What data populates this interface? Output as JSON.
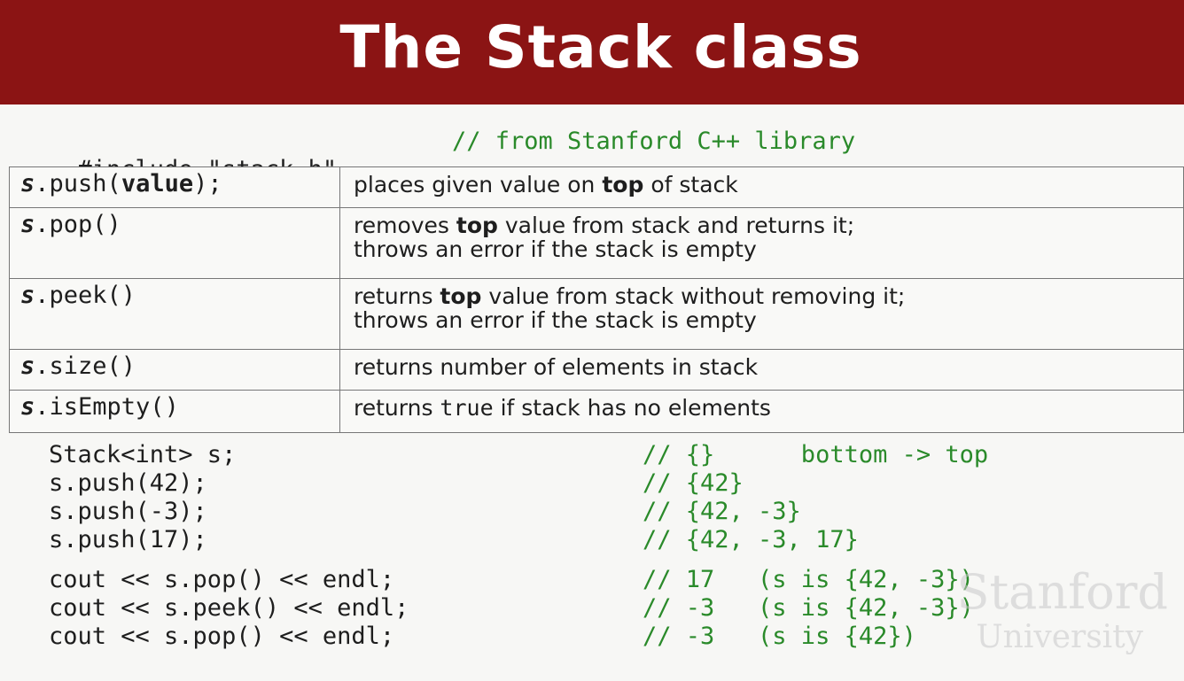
{
  "title": "The Stack class",
  "include": {
    "code": "#include \"stack.h\"",
    "comment": "// from Stanford C++ library"
  },
  "api": [
    {
      "obj": "s",
      "method": ".push(",
      "method_bold": "value",
      "method_tail": ");",
      "desc_lines": [
        {
          "parts": [
            {
              "t": "places given value on "
            },
            {
              "t": "top",
              "b": true
            },
            {
              "t": " of stack"
            }
          ]
        }
      ]
    },
    {
      "obj": "s",
      "method": ".pop()",
      "method_bold": "",
      "method_tail": "",
      "desc_lines": [
        {
          "parts": [
            {
              "t": "removes "
            },
            {
              "t": "top",
              "b": true
            },
            {
              "t": " value from stack and returns it;"
            }
          ]
        },
        {
          "parts": [
            {
              "t": "throws an error if the stack is empty"
            }
          ]
        }
      ]
    },
    {
      "obj": "s",
      "method": ".peek()",
      "method_bold": "",
      "method_tail": "",
      "desc_lines": [
        {
          "parts": [
            {
              "t": "returns "
            },
            {
              "t": "top",
              "b": true
            },
            {
              "t": " value from stack without removing it;"
            }
          ]
        },
        {
          "parts": [
            {
              "t": "throws an error if the stack is empty"
            }
          ]
        }
      ]
    },
    {
      "obj": "s",
      "method": ".size()",
      "method_bold": "",
      "method_tail": "",
      "desc_lines": [
        {
          "parts": [
            {
              "t": "returns number of elements in stack"
            }
          ]
        }
      ]
    },
    {
      "obj": "s",
      "method": ".isEmpty()",
      "method_bold": "",
      "method_tail": "",
      "desc_lines": [
        {
          "parts": [
            {
              "t": "returns "
            },
            {
              "t": "true",
              "code": true
            },
            {
              "t": " if stack has no elements"
            }
          ]
        }
      ]
    }
  ],
  "example": [
    {
      "code": "Stack<int> s;",
      "comment": "// {}      bottom -> top"
    },
    {
      "code": "s.push(42);",
      "comment": "// {42}"
    },
    {
      "code": "s.push(-3);",
      "comment": "// {42, -3}"
    },
    {
      "code": "s.push(17);",
      "comment": "// {42, -3, 17}"
    },
    {
      "code": "cout << s.pop() << endl;",
      "comment": "// 17   (s is {42, -3})"
    },
    {
      "code": "cout << s.peek() << endl;",
      "comment": "// -3   (s is {42, -3})"
    },
    {
      "code": "cout << s.pop() << endl;",
      "comment": "// -3   (s is {42})"
    }
  ],
  "watermark": {
    "line1": "Stanford",
    "line2": "University"
  }
}
